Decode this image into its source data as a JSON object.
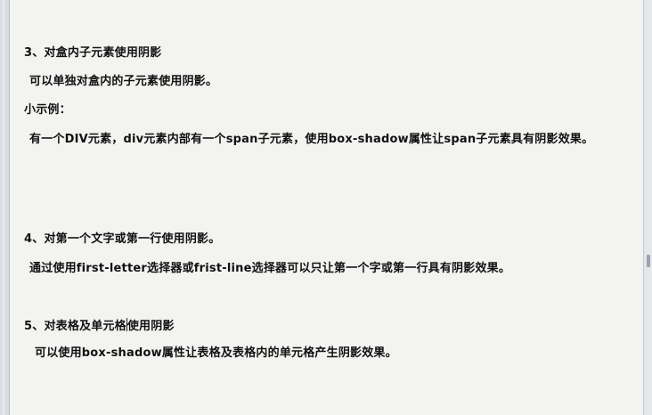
{
  "sections": [
    {
      "heading": "3、对盒内子元素使用阴影",
      "body": "可以单独对盒内的子元素使用阴影。",
      "example_label": "小示例：",
      "example_body": "有一个DIV元素，div元素内部有一个span子元素，使用box-shadow属性让span子元素具有阴影效果。"
    },
    {
      "heading": "4、对第一个文字或第一行使用阴影。",
      "body": "通过使用first-letter选择器或frist-line选择器可以只让第一个字或第一行具有阴影效果。"
    },
    {
      "heading_before_caret": "5、对表格及单元格",
      "heading_after_caret": "使用阴影",
      "body": "可以使用box-shadow属性让表格及表格内的单元格产生阴影效果。"
    }
  ]
}
